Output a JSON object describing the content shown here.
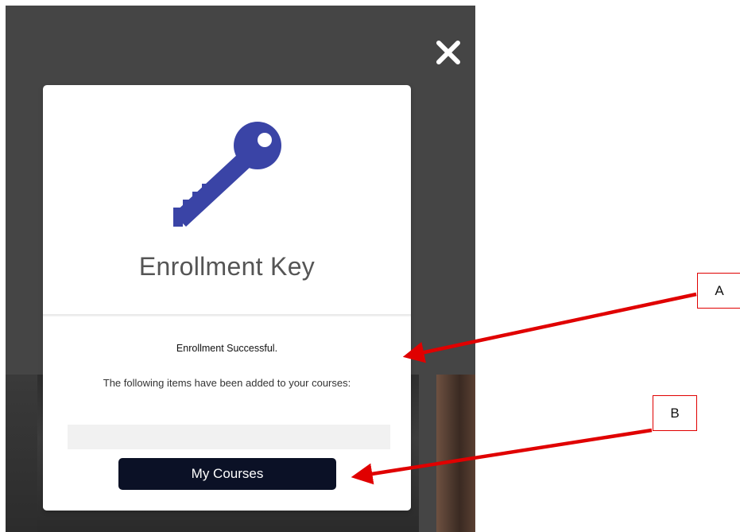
{
  "modal": {
    "title": "Enrollment Key",
    "icon": "key-icon",
    "accent_color": "#3a44a6",
    "result_heading": "Enrollment Successful.",
    "result_message": "The following items have been added to your courses:",
    "primary_button_label": "My Courses",
    "primary_button_color": "#0b1126",
    "close_icon": "close-icon"
  },
  "annotations": {
    "callout_a_label": "A",
    "callout_b_label": "B",
    "color": "#e00000"
  }
}
